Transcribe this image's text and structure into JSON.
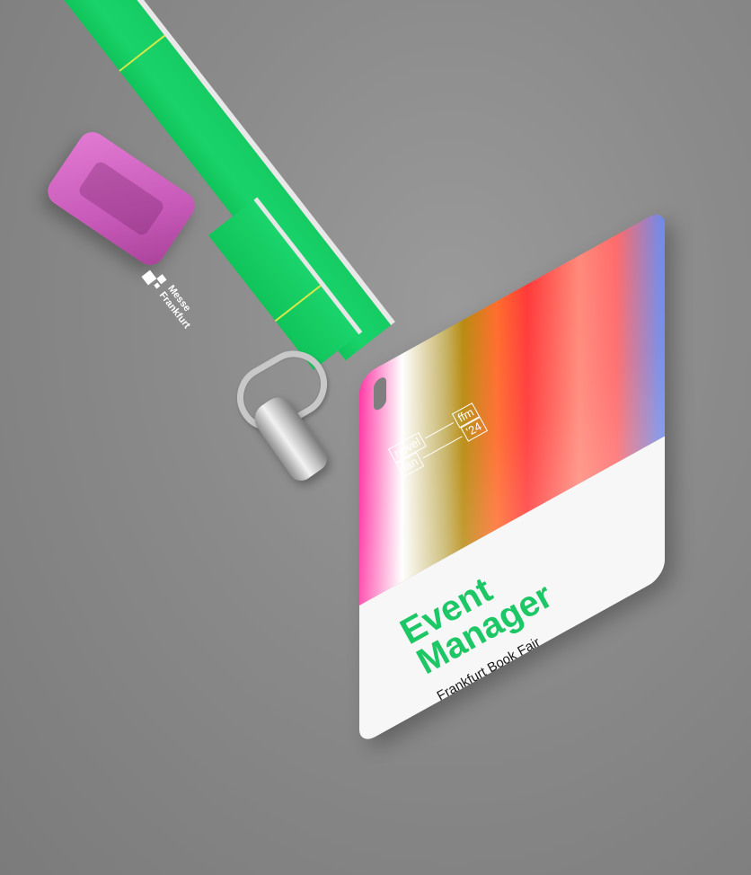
{
  "lanyard": {
    "brand_line1": "Messe",
    "brand_line2": "Frankfurt",
    "strap_color": "#19d36a",
    "buckle_color": "#d86cc8"
  },
  "badge": {
    "logo_line1_a": "novel",
    "logo_line1_b": "ffm",
    "logo_line2_a": "fan",
    "logo_line2_b": "'24",
    "title_line1": "Event",
    "title_line2": "Manager",
    "subtitle": "Frankfurt Book Fair",
    "title_color": "#1ec765"
  }
}
